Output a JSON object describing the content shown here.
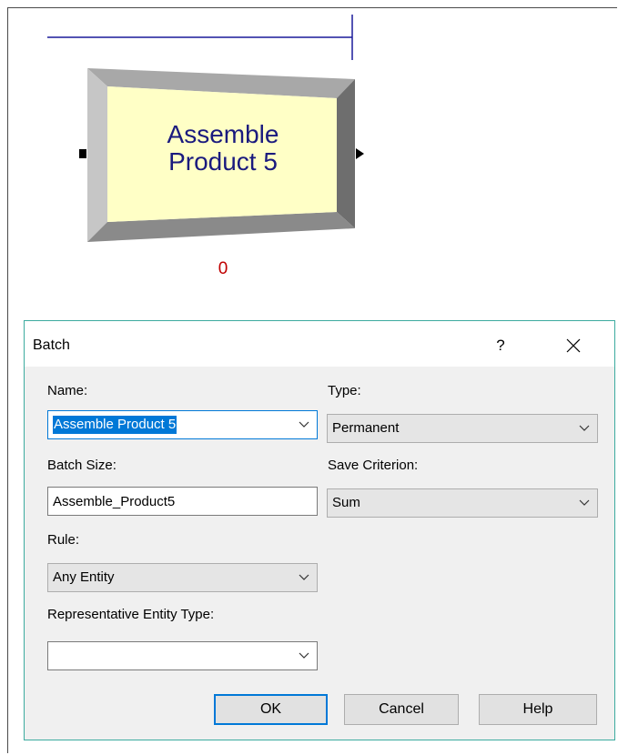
{
  "module": {
    "label_line1": "Assemble",
    "label_line2": "Product 5",
    "counter": "0",
    "colors": {
      "face": "#ffffc6",
      "label": "#1a1a7e",
      "counter": "#c00000",
      "bar": "#1a1a9a"
    }
  },
  "dialog": {
    "title": "Batch",
    "help_label": "?",
    "close_icon": "close-icon",
    "fields": {
      "name": {
        "label": "Name:",
        "value": "Assemble Product 5"
      },
      "type": {
        "label": "Type:",
        "value": "Permanent"
      },
      "batch_size": {
        "label": "Batch Size:",
        "value": "Assemble_Product5"
      },
      "save_criterion": {
        "label": "Save Criterion:",
        "value": "Sum"
      },
      "rule": {
        "label": "Rule:",
        "value": "Any Entity"
      },
      "rep_entity_type": {
        "label": "Representative Entity Type:",
        "value": ""
      }
    },
    "buttons": {
      "ok": "OK",
      "cancel": "Cancel",
      "help": "Help"
    }
  }
}
